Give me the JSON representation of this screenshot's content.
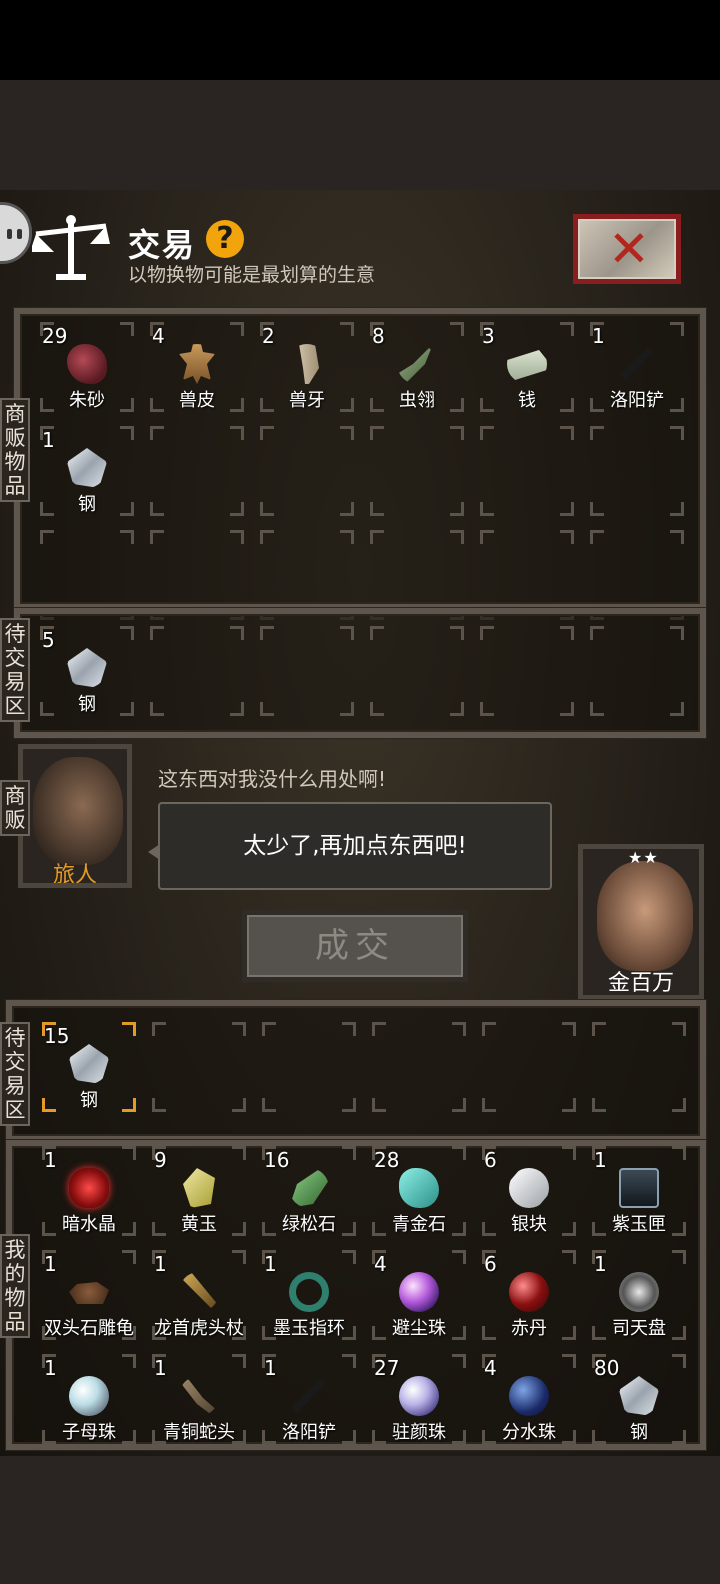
{
  "header": {
    "title": "交易",
    "help": "?",
    "subtitle": "以物换物可能是最划算的生意"
  },
  "labels": {
    "merchant_goods": "商贩物品",
    "pending_top": "待交易区",
    "merchant": "商贩",
    "pending_bottom": "待交易区",
    "my_goods": "我的物品"
  },
  "merchant_items": [
    {
      "count": "29",
      "name": "朱砂",
      "icon": "cinnabar"
    },
    {
      "count": "4",
      "name": "兽皮",
      "icon": "hide"
    },
    {
      "count": "2",
      "name": "兽牙",
      "icon": "tooth"
    },
    {
      "count": "8",
      "name": "虫翎",
      "icon": "wing"
    },
    {
      "count": "3",
      "name": "钱",
      "icon": "money"
    },
    {
      "count": "1",
      "name": "洛阳铲",
      "icon": "shovel"
    },
    {
      "count": "1",
      "name": "钢",
      "icon": "steel"
    }
  ],
  "merchant_pending": [
    {
      "count": "5",
      "name": "钢",
      "icon": "steel"
    }
  ],
  "dialogue": {
    "merchant_name": "旅人",
    "remark": "这东西对我没什么用处啊!",
    "bubble": "太少了,再加点东西吧!",
    "deal_button": "成交",
    "player_name": "金百万",
    "player_stars": "★★"
  },
  "my_pending": [
    {
      "count": "15",
      "name": "钢",
      "icon": "steel"
    }
  ],
  "my_items": [
    {
      "count": "1",
      "name": "暗水晶",
      "icon": "redcrystal"
    },
    {
      "count": "9",
      "name": "黄玉",
      "icon": "yellowjade"
    },
    {
      "count": "16",
      "name": "绿松石",
      "icon": "turq"
    },
    {
      "count": "28",
      "name": "青金石",
      "icon": "lapis"
    },
    {
      "count": "6",
      "name": "银块",
      "icon": "silver"
    },
    {
      "count": "1",
      "name": "紫玉匣",
      "icon": "box"
    },
    {
      "count": "1",
      "name": "双头石雕龟",
      "icon": "turtle"
    },
    {
      "count": "1",
      "name": "龙首虎头杖",
      "icon": "staff"
    },
    {
      "count": "1",
      "name": "墨玉指环",
      "icon": "ring"
    },
    {
      "count": "4",
      "name": "避尘珠",
      "icon": "pearl-purple"
    },
    {
      "count": "6",
      "name": "赤丹",
      "icon": "red-pill"
    },
    {
      "count": "1",
      "name": "司天盘",
      "icon": "compass"
    },
    {
      "count": "1",
      "name": "子母珠",
      "icon": "pearl-rainbow"
    },
    {
      "count": "1",
      "name": "青铜蛇头",
      "icon": "snake"
    },
    {
      "count": "1",
      "name": "洛阳铲",
      "icon": "shovel"
    },
    {
      "count": "27",
      "name": "驻颜珠",
      "icon": "pearl-violet"
    },
    {
      "count": "4",
      "name": "分水珠",
      "icon": "pearl-blue"
    },
    {
      "count": "80",
      "name": "钢",
      "icon": "steel"
    }
  ]
}
